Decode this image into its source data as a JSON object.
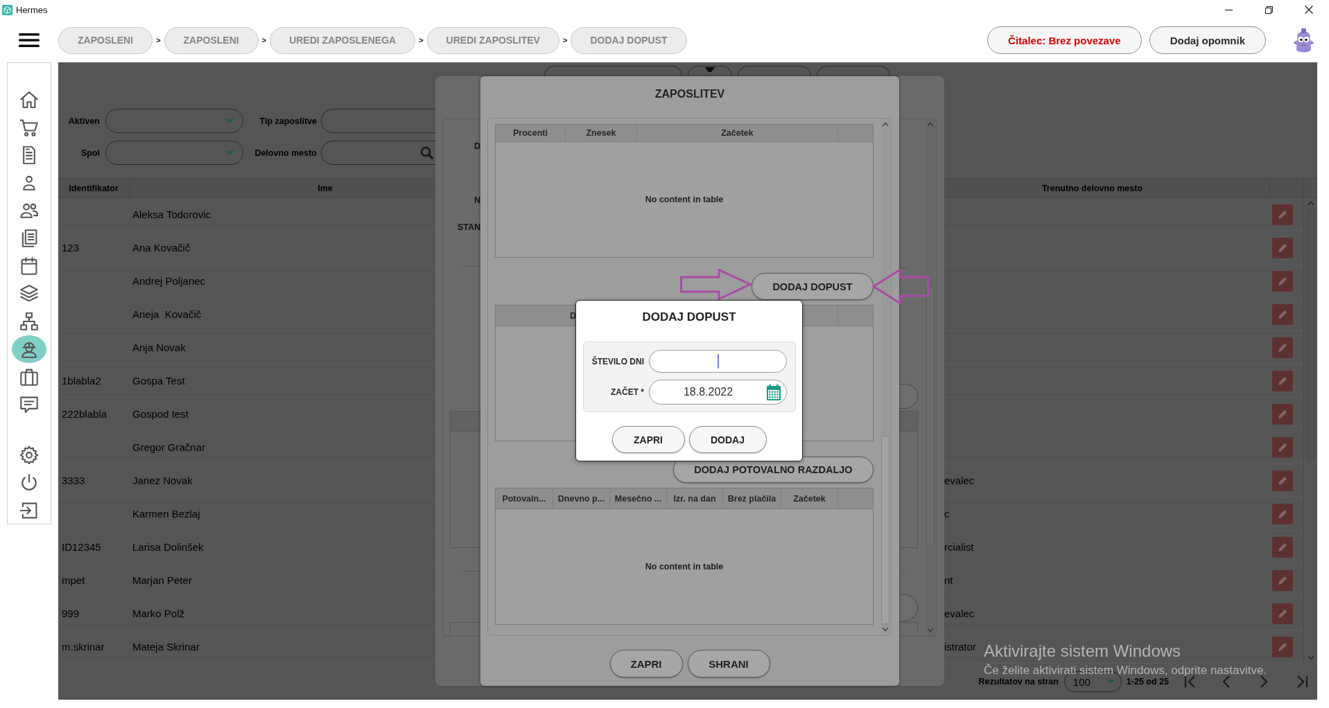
{
  "window": {
    "title": "Hermes"
  },
  "header": {
    "breadcrumbs": [
      {
        "label": "ZAPOSLENI"
      },
      {
        "separator": ">",
        "label": "ZAPOSLENI"
      },
      {
        "separator": ">",
        "label": "UREDI ZAPOSLENEGA"
      },
      {
        "separator": ">",
        "label": "UREDI ZAPOSLITEV"
      },
      {
        "separator": ">",
        "label": "DODAJ DOPUST"
      }
    ],
    "actions": [
      {
        "label": "Čitalec: Brez povezave",
        "kind": "alert"
      },
      {
        "label": "Dodaj opomnik",
        "kind": "plain"
      }
    ]
  },
  "sidebar": {
    "items": [
      {
        "kind": "home",
        "selected": false
      },
      {
        "kind": "cart",
        "selected": false
      },
      {
        "kind": "document",
        "selected": false
      },
      {
        "kind": "person",
        "selected": false
      },
      {
        "kind": "people",
        "selected": false
      },
      {
        "kind": "documents",
        "selected": false
      },
      {
        "kind": "calendar",
        "selected": false
      },
      {
        "kind": "layers",
        "selected": false
      },
      {
        "kind": "hierarchy",
        "selected": false
      },
      {
        "kind": "worker",
        "selected": true
      },
      {
        "kind": "briefcase",
        "selected": false
      },
      {
        "kind": "chat",
        "selected": false
      }
    ],
    "bottom_items": [
      {
        "kind": "settings",
        "selected": false
      },
      {
        "kind": "power",
        "selected": false
      },
      {
        "kind": "enter",
        "selected": false
      }
    ]
  },
  "filters": [
    {
      "label": "Aktiven",
      "kind": "select"
    },
    {
      "label": "Tip zaposlitve",
      "kind": "text"
    },
    {
      "label": "Spol",
      "kind": "select"
    },
    {
      "label": "Delovno mesto",
      "kind": "search"
    }
  ],
  "table": {
    "columns": [
      "Identifikator",
      "Ime",
      "Trenutno delovno mesto"
    ],
    "rows": [
      {
        "name": "Aleksa Todorovic"
      },
      {
        "id": "123",
        "name": "Ana Kovačič"
      },
      {
        "name": "Andrej Poljanec"
      },
      {
        "name": "Aneja  Kovačič"
      },
      {
        "name": "Anja Novak"
      },
      {
        "id": "1blabla2",
        "name": "Gospa Test"
      },
      {
        "id": "222blabla",
        "name": "Gospod test"
      },
      {
        "name": "Gregor Gračnar"
      },
      {
        "id": "3333",
        "name": "Janez Novak",
        "current_position": "evalec"
      },
      {
        "name": "Karmen Bezlaj",
        "current_position": "c"
      },
      {
        "id": "ID12345",
        "name": "Larisa Dolinšek",
        "current_position": "rcialist"
      },
      {
        "id": "mpet",
        "name": "Marjan Peter",
        "current_position": "nt"
      },
      {
        "id": "999",
        "name": "Marko Polž",
        "current_position": "evalec"
      },
      {
        "id": "m.skrinar",
        "name": "Mateja Skrinar",
        "current_position": "istrator"
      }
    ]
  },
  "pagination": {
    "label": "Rezultatov na stran",
    "page_size": "100",
    "range": "1-25 od 25"
  },
  "outer_dialog": {
    "labels": [
      "D",
      "N",
      "STAN"
    ]
  },
  "employment_dialog": {
    "title": "ZAPOSLITEV",
    "sections": [
      {
        "kind": "table",
        "columns": [
          "Procenti",
          "Znesek",
          "Začetek"
        ],
        "empty_text": "No content in table"
      },
      {
        "kind": "button",
        "label": "DODAJ DOPUST",
        "highlighted": true
      },
      {
        "kind": "table",
        "columns": [
          "D"
        ]
      },
      {
        "kind": "button",
        "label": "DODAJ POTOVALNO RAZDALJO",
        "highlighted": false
      },
      {
        "kind": "table",
        "columns": [
          "Potovaln...",
          "Dnevno p...",
          "Mesečno ...",
          "Izr. na dan",
          "Brez plačila",
          "Začetek"
        ],
        "empty_text": "No content in table"
      }
    ],
    "buttons": [
      "ZAPRI",
      "SHRANI"
    ]
  },
  "leave_dialog": {
    "title": "DODAJ DOPUST",
    "fields": [
      {
        "label": "ŠTEVILO DNI",
        "kind": "number",
        "focused": true
      },
      {
        "label": "ZAČET *",
        "kind": "date",
        "value": "18.8.2022"
      }
    ],
    "buttons": [
      "ZAPRI",
      "DODAJ"
    ]
  },
  "system_notice": {
    "title": "Aktivirajte sistem Windows",
    "text": "Če želite aktivirati sistem Windows, odprite nastavitve."
  }
}
